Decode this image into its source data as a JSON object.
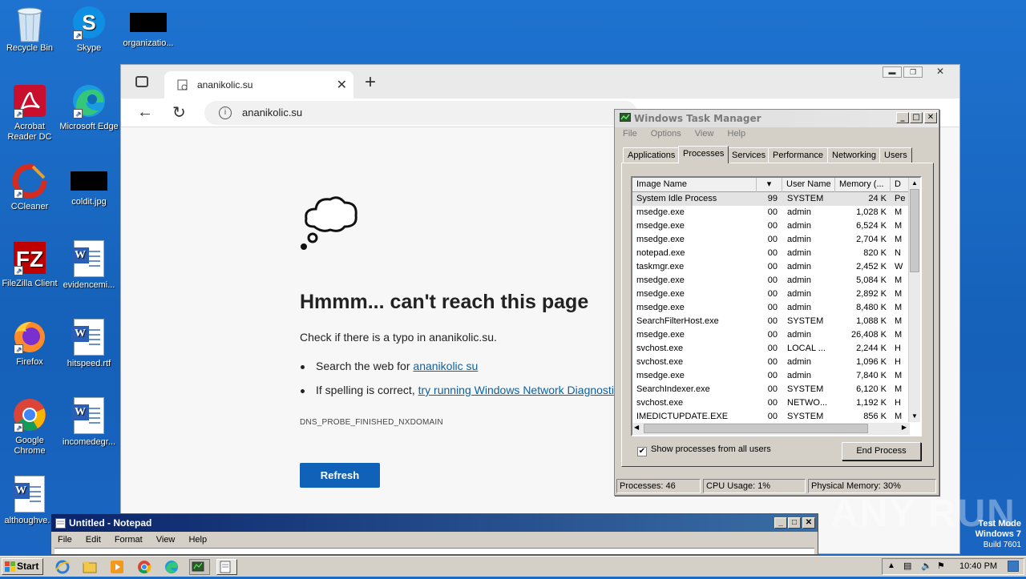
{
  "desktop": {
    "icons": [
      {
        "label": "Recycle Bin"
      },
      {
        "label": "Skype"
      },
      {
        "label": "organizatio..."
      },
      {
        "label": "Acrobat Reader DC"
      },
      {
        "label": "Microsoft Edge"
      },
      {
        "label": "CCleaner"
      },
      {
        "label": "coldit.jpg"
      },
      {
        "label": "FileZilla Client"
      },
      {
        "label": "evidencemi..."
      },
      {
        "label": "Firefox"
      },
      {
        "label": "hitspeed.rtf"
      },
      {
        "label": "Google Chrome"
      },
      {
        "label": "incomedegr..."
      },
      {
        "label": "althoughve..."
      }
    ]
  },
  "edge": {
    "tab_title": "ananikolic.su",
    "url": "ananikolic.su",
    "error": {
      "heading": "Hmmm... can't reach this page",
      "line1": "Check if there is a typo in ananikolic.su.",
      "bullet1_prefix": "Search the web for ",
      "bullet1_link": "ananikolic su",
      "bullet2_prefix": "If spelling is correct, ",
      "bullet2_link": "try running Windows Network Diagnostic",
      "code": "DNS_PROBE_FINISHED_NXDOMAIN",
      "refresh_label": "Refresh"
    }
  },
  "task_manager": {
    "title": "Windows Task Manager",
    "menu": [
      "File",
      "Options",
      "View",
      "Help"
    ],
    "tabs": [
      "Applications",
      "Processes",
      "Services",
      "Performance",
      "Networking",
      "Users"
    ],
    "active_tab": "Processes",
    "columns": [
      "Image Name",
      "",
      "User Name",
      "Memory (...",
      "D"
    ],
    "rows": [
      {
        "name": "System Idle Process",
        "cpu": "99",
        "user": "SYSTEM",
        "mem": "24 K",
        "d": "Pe"
      },
      {
        "name": "msedge.exe",
        "cpu": "00",
        "user": "admin",
        "mem": "1,028 K",
        "d": "M"
      },
      {
        "name": "msedge.exe",
        "cpu": "00",
        "user": "admin",
        "mem": "6,524 K",
        "d": "M"
      },
      {
        "name": "msedge.exe",
        "cpu": "00",
        "user": "admin",
        "mem": "2,704 K",
        "d": "M"
      },
      {
        "name": "notepad.exe",
        "cpu": "00",
        "user": "admin",
        "mem": "820 K",
        "d": "N"
      },
      {
        "name": "taskmgr.exe",
        "cpu": "00",
        "user": "admin",
        "mem": "2,452 K",
        "d": "W"
      },
      {
        "name": "msedge.exe",
        "cpu": "00",
        "user": "admin",
        "mem": "5,084 K",
        "d": "M"
      },
      {
        "name": "msedge.exe",
        "cpu": "00",
        "user": "admin",
        "mem": "2,892 K",
        "d": "M"
      },
      {
        "name": "msedge.exe",
        "cpu": "00",
        "user": "admin",
        "mem": "8,480 K",
        "d": "M"
      },
      {
        "name": "SearchFilterHost.exe",
        "cpu": "00",
        "user": "SYSTEM",
        "mem": "1,088 K",
        "d": "M"
      },
      {
        "name": "msedge.exe",
        "cpu": "00",
        "user": "admin",
        "mem": "26,408 K",
        "d": "M"
      },
      {
        "name": "svchost.exe",
        "cpu": "00",
        "user": "LOCAL ...",
        "mem": "2,244 K",
        "d": "H"
      },
      {
        "name": "svchost.exe",
        "cpu": "00",
        "user": "admin",
        "mem": "1,096 K",
        "d": "H"
      },
      {
        "name": "msedge.exe",
        "cpu": "00",
        "user": "admin",
        "mem": "7,840 K",
        "d": "M"
      },
      {
        "name": "SearchIndexer.exe",
        "cpu": "00",
        "user": "SYSTEM",
        "mem": "6,120 K",
        "d": "M"
      },
      {
        "name": "svchost.exe",
        "cpu": "00",
        "user": "NETWO...",
        "mem": "1,192 K",
        "d": "H"
      },
      {
        "name": "IMEDICTUPDATE.EXE",
        "cpu": "00",
        "user": "SYSTEM",
        "mem": "856 K",
        "d": "M"
      }
    ],
    "show_all_label": "Show processes from all users",
    "end_process_label": "End Process",
    "status": {
      "processes": "Processes: 46",
      "cpu": "CPU Usage: 1%",
      "memory": "Physical Memory: 30%"
    }
  },
  "notepad": {
    "title": "Untitled - Notepad",
    "menu": [
      "File",
      "Edit",
      "Format",
      "View",
      "Help"
    ]
  },
  "taskbar": {
    "start_label": "Start",
    "clock": "10:40 PM"
  },
  "watermark": "ANY RUN",
  "test_mode": {
    "line1": "Test Mode",
    "line2": "Windows 7",
    "line3": "Build 7601"
  }
}
